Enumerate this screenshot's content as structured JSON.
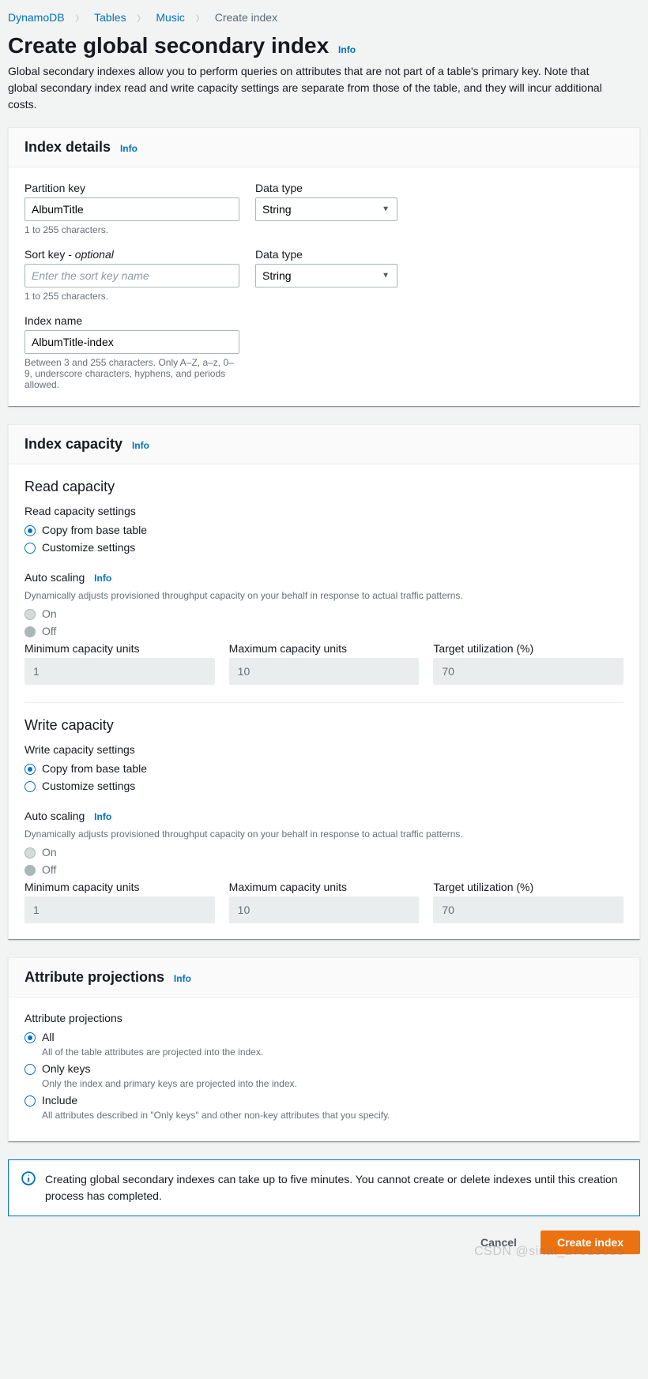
{
  "breadcrumbs": {
    "items": [
      "DynamoDB",
      "Tables",
      "Music"
    ],
    "current": "Create index"
  },
  "page": {
    "title": "Create global secondary index",
    "info": "Info",
    "description": "Global secondary indexes allow you to perform queries on attributes that are not part of a table's primary key. Note that global secondary index read and write capacity settings are separate from those of the table, and they will incur additional costs."
  },
  "indexDetails": {
    "header": "Index details",
    "info": "Info",
    "partitionKey": {
      "label": "Partition key",
      "value": "AlbumTitle",
      "hint": "1 to 255 characters."
    },
    "partitionType": {
      "label": "Data type",
      "value": "String"
    },
    "sortKey": {
      "label": "Sort key - ",
      "optional": "optional",
      "placeholder": "Enter the sort key name",
      "hint": "1 to 255 characters."
    },
    "sortType": {
      "label": "Data type",
      "value": "String"
    },
    "indexName": {
      "label": "Index name",
      "value": "AlbumTitle-index",
      "hint": "Between 3 and 255 characters. Only A–Z, a–z, 0–9, underscore characters, hyphens, and periods allowed."
    }
  },
  "indexCapacity": {
    "header": "Index capacity",
    "info": "Info",
    "read": {
      "heading": "Read capacity",
      "settingsLabel": "Read capacity settings",
      "options": {
        "copy": "Copy from base table",
        "custom": "Customize settings"
      },
      "autoscaling": {
        "label": "Auto scaling",
        "info": "Info",
        "hint": "Dynamically adjusts provisioned throughput capacity on your behalf in response to actual traffic patterns.",
        "on": "On",
        "off": "Off"
      },
      "min": {
        "label": "Minimum capacity units",
        "value": "1"
      },
      "max": {
        "label": "Maximum capacity units",
        "value": "10"
      },
      "tgt": {
        "label": "Target utilization (%)",
        "value": "70"
      }
    },
    "write": {
      "heading": "Write capacity",
      "settingsLabel": "Write capacity settings",
      "options": {
        "copy": "Copy from base table",
        "custom": "Customize settings"
      },
      "autoscaling": {
        "label": "Auto scaling",
        "info": "Info",
        "hint": "Dynamically adjusts provisioned throughput capacity on your behalf in response to actual traffic patterns.",
        "on": "On",
        "off": "Off"
      },
      "min": {
        "label": "Minimum capacity units",
        "value": "1"
      },
      "max": {
        "label": "Maximum capacity units",
        "value": "10"
      },
      "tgt": {
        "label": "Target utilization (%)",
        "value": "70"
      }
    }
  },
  "projections": {
    "header": "Attribute projections",
    "info": "Info",
    "label": "Attribute projections",
    "options": {
      "all": {
        "title": "All",
        "desc": "All of the table attributes are projected into the index."
      },
      "keys": {
        "title": "Only keys",
        "desc": "Only the index and primary keys are projected into the index."
      },
      "include": {
        "title": "Include",
        "desc": "All attributes described in \"Only keys\" and other non-key attributes that you specify."
      }
    }
  },
  "alert": {
    "message": "Creating global secondary indexes can take up to five minutes. You cannot create or delete indexes until this creation process has completed."
  },
  "footer": {
    "cancel": "Cancel",
    "create": "Create index"
  },
  "watermark": "CSDN @sinat_27015055"
}
